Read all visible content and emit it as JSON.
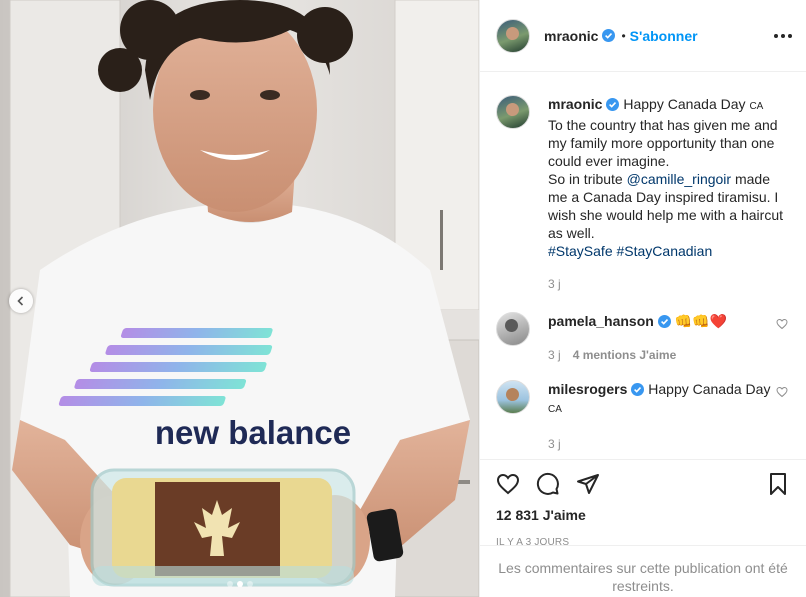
{
  "post": {
    "username": "mraonic",
    "follow_label": "S'abonner",
    "bullet": "•"
  },
  "caption": {
    "username": "mraonic",
    "line1": "Happy Canada Day",
    "ca": "CA",
    "text_a": "To the country that has given me and my family more opportunity than one could ever imagine.",
    "text_b_pre": "So in tribute",
    "mention": "@camille_ringoir",
    "text_b_post": "made me a Canada Day inspired tiramisu. I wish she would help me with a haircut as well.",
    "hashtag1": "#StaySafe",
    "hashtag2": "#StayCanadian",
    "age": "3 j"
  },
  "comments": [
    {
      "username": "pamela_hanson",
      "text": "👊👊❤️",
      "age": "3 j",
      "likes": "4 mentions J'aime"
    },
    {
      "username": "milesrogers",
      "text": "Happy Canada Day",
      "ca": "CA",
      "age": "3 j"
    }
  ],
  "footer": {
    "likes": "12 831 J'aime",
    "timestamp": "IL Y A 3 JOURS",
    "restricted": "Les commentaires sur cette publication ont été restreints."
  },
  "photo": {
    "shirt_logo": "NB",
    "shirt_text": "new balance"
  },
  "colors": {
    "accent": "#0095f6",
    "verified": "#3897f0",
    "text": "#262626",
    "muted": "#8e8e8e",
    "link": "#00376b"
  }
}
